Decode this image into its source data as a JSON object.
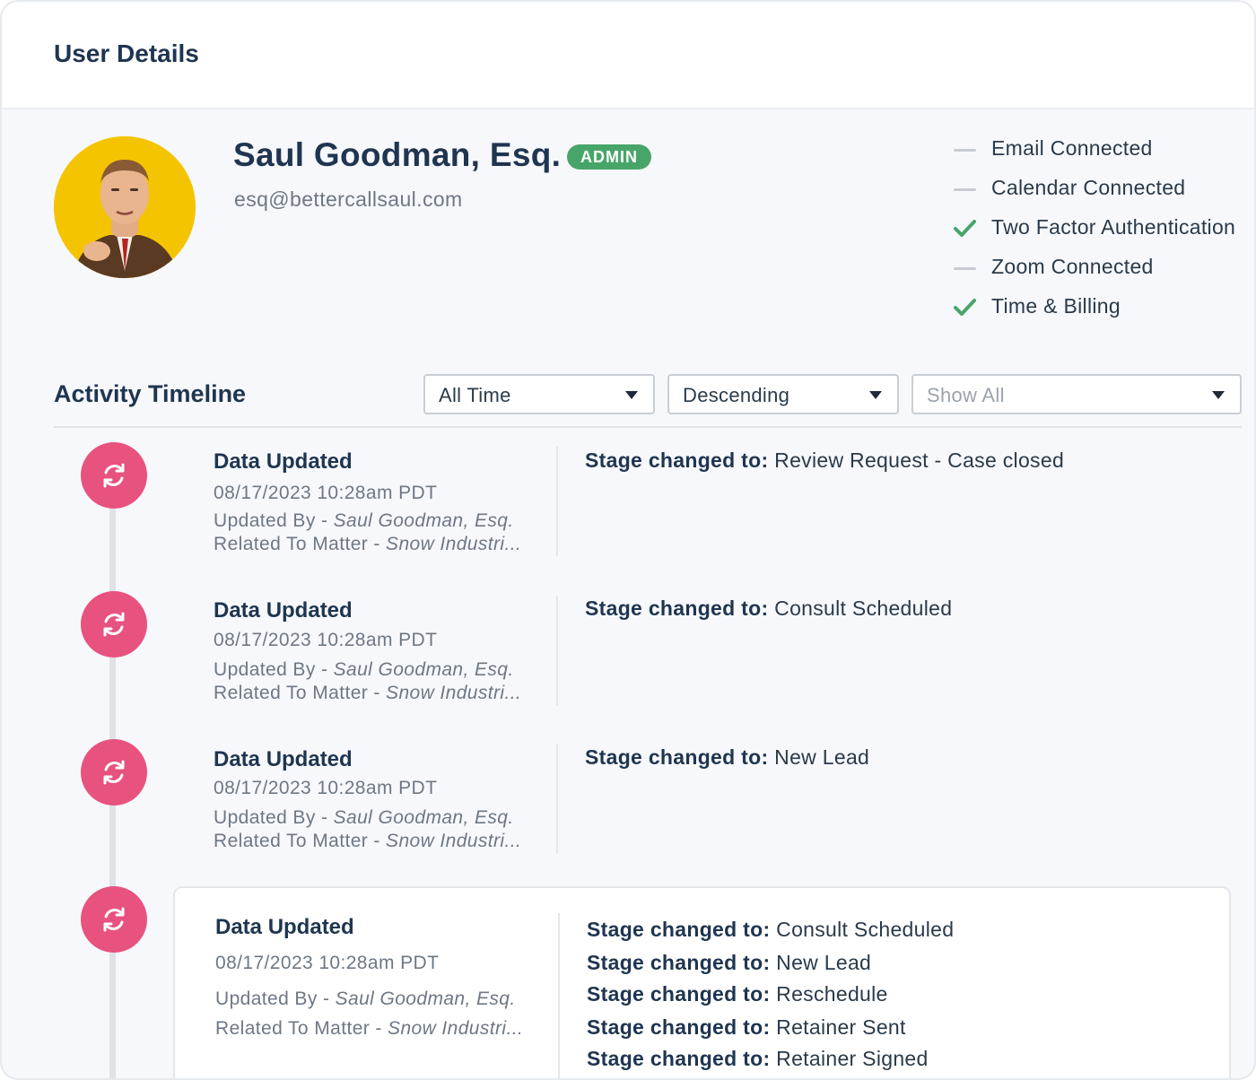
{
  "header": {
    "title": "User Details"
  },
  "user": {
    "name": "Saul Goodman, Esq.",
    "role_badge": "ADMIN",
    "email": "esq@bettercallsaul.com",
    "avatar_icon": "user-photo"
  },
  "connections": [
    {
      "label": "Email Connected",
      "status": "off"
    },
    {
      "label": "Calendar Connected",
      "status": "off"
    },
    {
      "label": "Two Factor Authentication",
      "status": "on"
    },
    {
      "label": "Zoom Connected",
      "status": "off"
    },
    {
      "label": "Time & Billing",
      "status": "on"
    }
  ],
  "timeline": {
    "title": "Activity Timeline",
    "filters": {
      "time_range": "All Time",
      "order": "Descending",
      "type": "Show All"
    },
    "entries": [
      {
        "title": "Data Updated",
        "timestamp": "08/17/2023 10:28am PDT",
        "updated_by_label": "Updated By - ",
        "updated_by": "Saul Goodman, Esq.",
        "matter_label": "Related To Matter - ",
        "matter": "Snow Industri...",
        "changes": [
          {
            "label": "Stage changed to:",
            "value": "Review Request - Case closed"
          }
        ]
      },
      {
        "title": "Data Updated",
        "timestamp": "08/17/2023 10:28am PDT",
        "updated_by_label": "Updated By - ",
        "updated_by": "Saul Goodman, Esq.",
        "matter_label": "Related To Matter - ",
        "matter": "Snow Industri...",
        "changes": [
          {
            "label": "Stage changed to:",
            "value": "Consult Scheduled"
          }
        ]
      },
      {
        "title": "Data Updated",
        "timestamp": "08/17/2023 10:28am PDT",
        "updated_by_label": "Updated By - ",
        "updated_by": "Saul Goodman, Esq.",
        "matter_label": "Related To Matter - ",
        "matter": "Snow Industri...",
        "changes": [
          {
            "label": "Stage changed to:",
            "value": "New Lead"
          }
        ]
      },
      {
        "title": "Data Updated",
        "timestamp": "08/17/2023 10:28am PDT",
        "updated_by_label": "Updated By - ",
        "updated_by": "Saul Goodman, Esq.",
        "matter_label": "Related To Matter - ",
        "matter": "Snow Industri...",
        "changes": [
          {
            "label": "Stage changed to:",
            "value": "Consult Scheduled"
          },
          {
            "label": "Stage changed to:",
            "value": "New Lead"
          },
          {
            "label": "Stage changed to:",
            "value": "Reschedule"
          },
          {
            "label": "Stage changed to:",
            "value": "Retainer Sent"
          },
          {
            "label": "Stage changed to:",
            "value": "Retainer Signed"
          }
        ]
      }
    ]
  },
  "colors": {
    "accent_pink": "#e8527f",
    "badge_green": "#48a56a",
    "check_green": "#48a56a",
    "heading": "#1f3550",
    "muted_text": "#6d7885"
  }
}
